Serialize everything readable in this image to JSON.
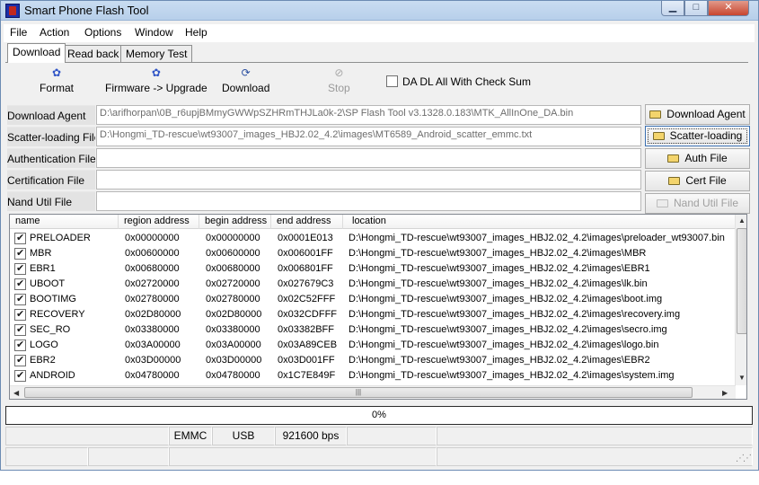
{
  "window": {
    "title": "Smart Phone Flash Tool"
  },
  "menu": [
    "File",
    "Action",
    "Options",
    "Window",
    "Help"
  ],
  "tabs": [
    "Download",
    "Read back",
    "Memory Test"
  ],
  "toolbar": {
    "format": "Format",
    "firmware_upgrade": "Firmware -> Upgrade",
    "download": "Download",
    "stop": "Stop",
    "da_checksum": "DA DL All With Check Sum",
    "da_checksum_checked": false
  },
  "fields": {
    "download_agent": {
      "label": "Download Agent",
      "value": "D:\\arifhorpan\\0B_r6upjBMmyGWWpSZHRmTHJLa0k-2\\SP Flash Tool v3.1328.0.183\\MTK_AllInOne_DA.bin",
      "button": "Download Agent"
    },
    "scatter": {
      "label": "Scatter-loading File",
      "value": "D:\\Hongmi_TD-rescue\\wt93007_images_HBJ2.02_4.2\\images\\MT6589_Android_scatter_emmc.txt",
      "button": "Scatter-loading"
    },
    "auth": {
      "label": "Authentication File",
      "value": "",
      "button": "Auth File"
    },
    "cert": {
      "label": "Certification File",
      "value": "",
      "button": "Cert File"
    },
    "nand": {
      "label": "Nand Util File",
      "value": "",
      "button": "Nand Util File"
    }
  },
  "table": {
    "columns": [
      "name",
      "region address",
      "begin address",
      "end address",
      "location"
    ],
    "rows": [
      {
        "checked": true,
        "name": "PRELOADER",
        "region": "0x00000000",
        "begin": "0x00000000",
        "end": "0x0001E013",
        "location": "D:\\Hongmi_TD-rescue\\wt93007_images_HBJ2.02_4.2\\images\\preloader_wt93007.bin"
      },
      {
        "checked": true,
        "name": "MBR",
        "region": "0x00600000",
        "begin": "0x00600000",
        "end": "0x006001FF",
        "location": "D:\\Hongmi_TD-rescue\\wt93007_images_HBJ2.02_4.2\\images\\MBR"
      },
      {
        "checked": true,
        "name": "EBR1",
        "region": "0x00680000",
        "begin": "0x00680000",
        "end": "0x006801FF",
        "location": "D:\\Hongmi_TD-rescue\\wt93007_images_HBJ2.02_4.2\\images\\EBR1"
      },
      {
        "checked": true,
        "name": "UBOOT",
        "region": "0x02720000",
        "begin": "0x02720000",
        "end": "0x027679C3",
        "location": "D:\\Hongmi_TD-rescue\\wt93007_images_HBJ2.02_4.2\\images\\lk.bin"
      },
      {
        "checked": true,
        "name": "BOOTIMG",
        "region": "0x02780000",
        "begin": "0x02780000",
        "end": "0x02C52FFF",
        "location": "D:\\Hongmi_TD-rescue\\wt93007_images_HBJ2.02_4.2\\images\\boot.img"
      },
      {
        "checked": true,
        "name": "RECOVERY",
        "region": "0x02D80000",
        "begin": "0x02D80000",
        "end": "0x032CDFFF",
        "location": "D:\\Hongmi_TD-rescue\\wt93007_images_HBJ2.02_4.2\\images\\recovery.img"
      },
      {
        "checked": true,
        "name": "SEC_RO",
        "region": "0x03380000",
        "begin": "0x03380000",
        "end": "0x03382BFF",
        "location": "D:\\Hongmi_TD-rescue\\wt93007_images_HBJ2.02_4.2\\images\\secro.img"
      },
      {
        "checked": true,
        "name": "LOGO",
        "region": "0x03A00000",
        "begin": "0x03A00000",
        "end": "0x03A89CEB",
        "location": "D:\\Hongmi_TD-rescue\\wt93007_images_HBJ2.02_4.2\\images\\logo.bin"
      },
      {
        "checked": true,
        "name": "EBR2",
        "region": "0x03D00000",
        "begin": "0x03D00000",
        "end": "0x03D001FF",
        "location": "D:\\Hongmi_TD-rescue\\wt93007_images_HBJ2.02_4.2\\images\\EBR2"
      },
      {
        "checked": true,
        "name": "ANDROID",
        "region": "0x04780000",
        "begin": "0x04780000",
        "end": "0x1C7E849F",
        "location": "D:\\Hongmi_TD-rescue\\wt93007_images_HBJ2.02_4.2\\images\\system.img"
      }
    ]
  },
  "progress": {
    "text": "0%",
    "value": 0
  },
  "status": {
    "storage": "EMMC",
    "connection": "USB",
    "baud": "921600 bps"
  },
  "icons": {
    "format": "format-icon",
    "upgrade": "firmware-upgrade-icon",
    "download": "download-icon",
    "stop": "stop-icon",
    "folder": "folder-icon"
  },
  "colors": {
    "title_bar": "#b7cfea",
    "close_button": "#c8452f"
  }
}
